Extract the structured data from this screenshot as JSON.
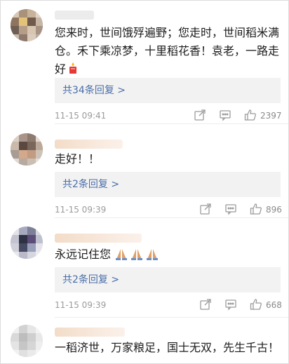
{
  "comments": [
    {
      "text": "您来时，世间饿殍遍野；您走时，世间稻米满仓。禾下乘凉梦，十里稻花香！袁老，一路走好",
      "emoji": "candle",
      "reply_label": "共34条回复 >",
      "time": "11-15 09:41",
      "likes": "2397"
    },
    {
      "text": "走好！！",
      "reply_label": "共2条回复 >",
      "time": "11-15 09:39",
      "likes": "896"
    },
    {
      "text": "永远记住您",
      "emoji": "praying-hands x3",
      "reply_label": "共2条回复 >",
      "time": "11-15 09:39",
      "likes": "668"
    },
    {
      "text": "一稻济世，万家粮足，国士无双，先生千古！"
    }
  ],
  "colors": {
    "link": "#4a6ea8",
    "meta": "#9b9b9b",
    "reply_bg": "#f2f2f2"
  }
}
